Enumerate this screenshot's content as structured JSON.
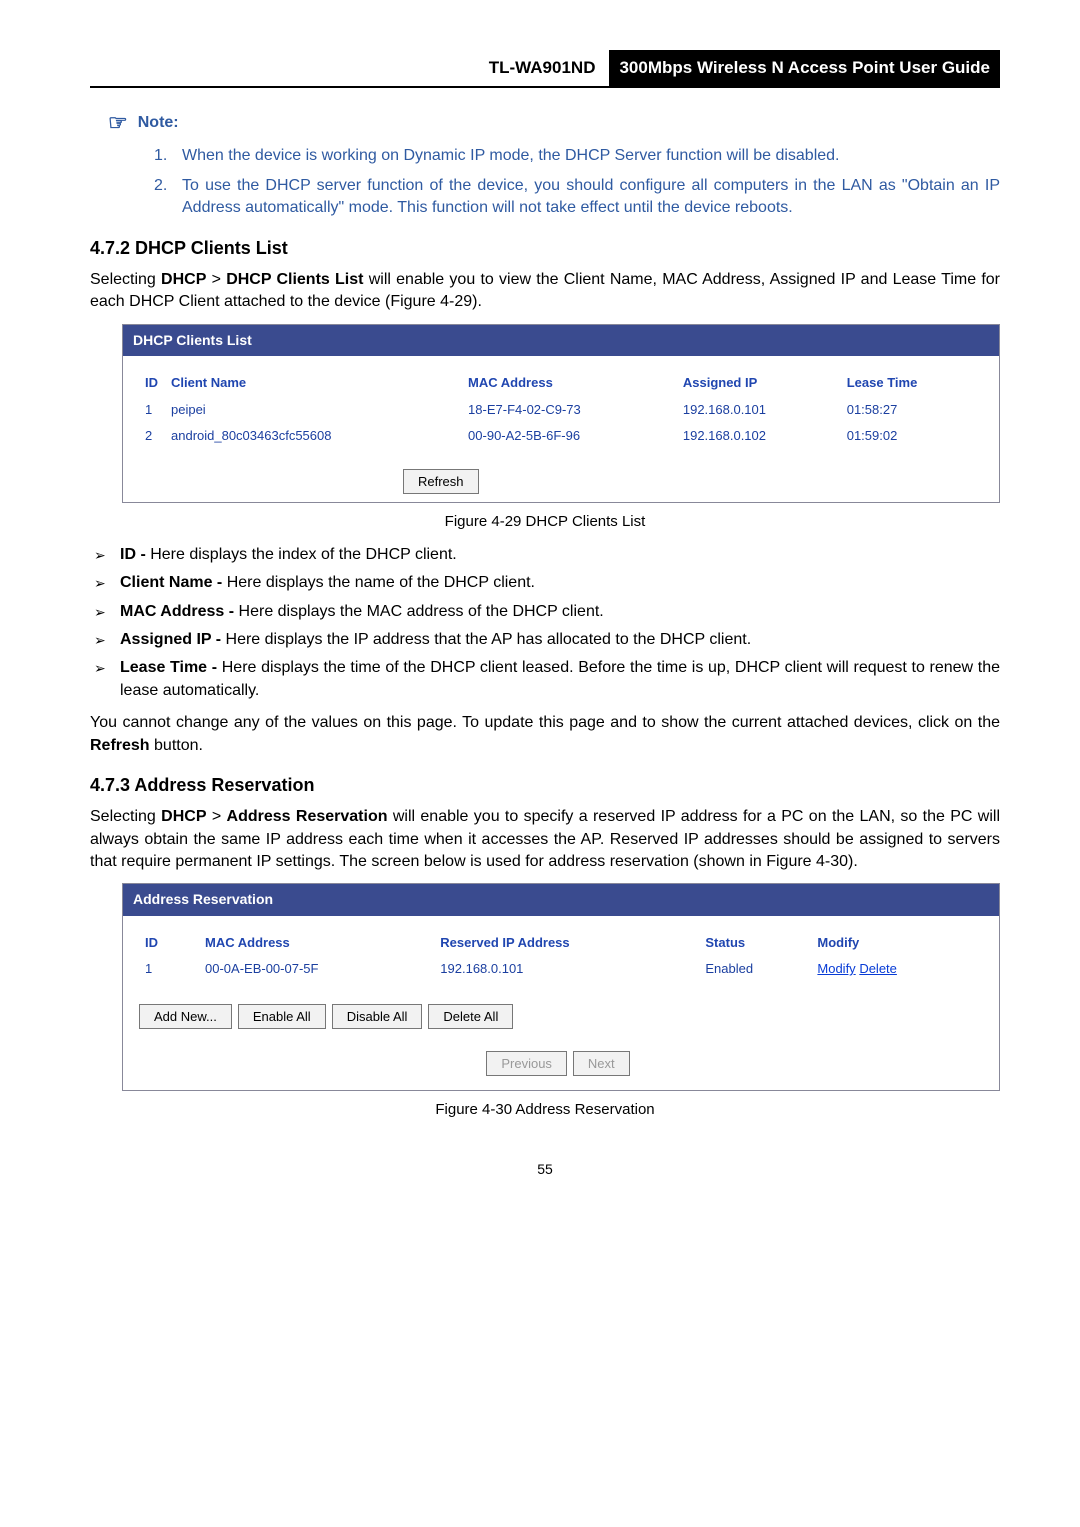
{
  "header": {
    "model": "TL-WA901ND",
    "guide_title": "300Mbps Wireless N Access Point User Guide"
  },
  "note": {
    "icon": "☞",
    "label": "Note:",
    "items": [
      "When the device is working on Dynamic IP mode, the DHCP Server function will be disabled.",
      "To use the DHCP server function of the device, you should configure all computers in the LAN as \"Obtain an IP Address automatically\" mode. This function will not take effect until the device reboots."
    ]
  },
  "s472": {
    "heading": "4.7.2  DHCP Clients List",
    "intro_pre": "Selecting ",
    "intro_bold1": "DHCP",
    "intro_gt": " > ",
    "intro_bold2": "DHCP Clients List",
    "intro_post": " will enable you to view the Client Name, MAC Address, Assigned IP and Lease Time for each DHCP Client attached to the device (Figure 4-29).",
    "panel_title": "DHCP Clients List",
    "table": {
      "headers": [
        "ID",
        "Client Name",
        "MAC Address",
        "Assigned IP",
        "Lease Time"
      ],
      "rows": [
        [
          "1",
          "peipei",
          "18-E7-F4-02-C9-73",
          "192.168.0.101",
          "01:58:27"
        ],
        [
          "2",
          "android_80c03463cfc55608",
          "00-90-A2-5B-6F-96",
          "192.168.0.102",
          "01:59:02"
        ]
      ]
    },
    "refresh_label": "Refresh",
    "caption": "Figure 4-29 DHCP Clients List",
    "bullets": [
      {
        "bold": "ID - ",
        "text": "Here displays the index of the DHCP client."
      },
      {
        "bold": "Client Name - ",
        "text": "Here displays the name of the DHCP client."
      },
      {
        "bold": "MAC Address - ",
        "text": "Here displays the MAC address of the DHCP client."
      },
      {
        "bold": "Assigned IP - ",
        "text": "Here displays the IP address that the AP has allocated to the DHCP client."
      },
      {
        "bold": "Lease Time - ",
        "text": "Here displays the time of the DHCP client leased. Before the time is up, DHCP client will request to renew the lease automatically."
      }
    ],
    "closing_pre": "You cannot change any of the values on this page. To update this page and to show the current attached devices, click on the ",
    "closing_bold": "Refresh",
    "closing_post": " button."
  },
  "s473": {
    "heading": "4.7.3  Address Reservation",
    "intro_pre": "Selecting ",
    "intro_bold1": "DHCP",
    "intro_gt": " > ",
    "intro_bold2": "Address Reservation",
    "intro_post": " will enable you to specify a reserved IP address for a PC on the LAN, so the PC will always obtain the same IP address each time when it accesses the AP. Reserved IP addresses should be assigned to servers that require permanent IP settings. The screen below is used for address reservation (shown in Figure 4-30).",
    "panel_title": "Address Reservation",
    "table": {
      "headers": [
        "ID",
        "MAC Address",
        "Reserved IP Address",
        "Status",
        "Modify"
      ],
      "rows": [
        {
          "id": "1",
          "mac": "00-0A-EB-00-07-5F",
          "rip": "192.168.0.101",
          "status": "Enabled",
          "modify": "Modify",
          "delete": "Delete"
        }
      ]
    },
    "buttons": {
      "add_new": "Add New...",
      "enable_all": "Enable All",
      "disable_all": "Disable All",
      "delete_all": "Delete All",
      "previous": "Previous",
      "next": "Next"
    },
    "caption": "Figure 4-30 Address Reservation"
  },
  "page_number": "55"
}
